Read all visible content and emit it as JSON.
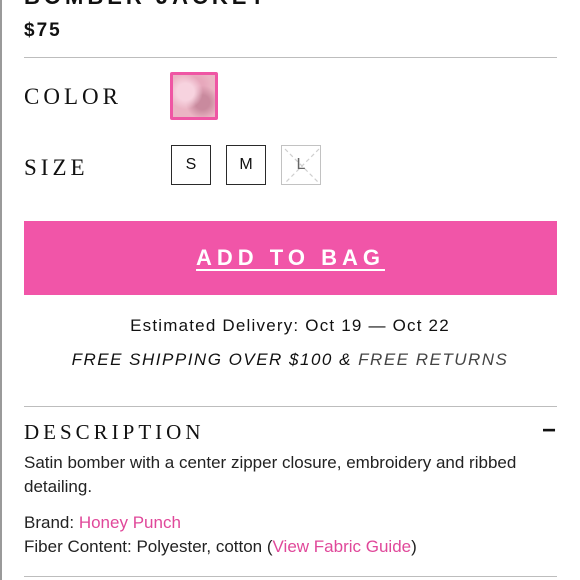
{
  "product": {
    "title": "BOMBER JACKET",
    "price": "$75"
  },
  "color": {
    "label": "COLOR",
    "swatch_color": "#ebb5c4",
    "selected_border": "#ef56a4"
  },
  "size": {
    "label": "SIZE",
    "options": [
      {
        "label": "S",
        "available": true
      },
      {
        "label": "M",
        "available": true
      },
      {
        "label": "L",
        "available": false
      }
    ]
  },
  "cta": {
    "add_to_bag": "ADD TO BAG",
    "color": "#f155a8"
  },
  "shipping": {
    "delivery": "Estimated Delivery: Oct 19 — Oct 22",
    "free_shipping": "FREE SHIPPING OVER $100 &",
    "free_returns": "FREE RETURNS"
  },
  "description": {
    "heading": "DESCRIPTION",
    "toggle": "−",
    "body": "Satin bomber with a center zipper closure, embroidery and ribbed detailing.",
    "brand_label": "Brand:",
    "brand_value": "Honey Punch",
    "fiber_label": "Fiber Content: Polyester, cotton (",
    "fiber_link": "View Fabric Guide",
    "fiber_close": ")"
  }
}
